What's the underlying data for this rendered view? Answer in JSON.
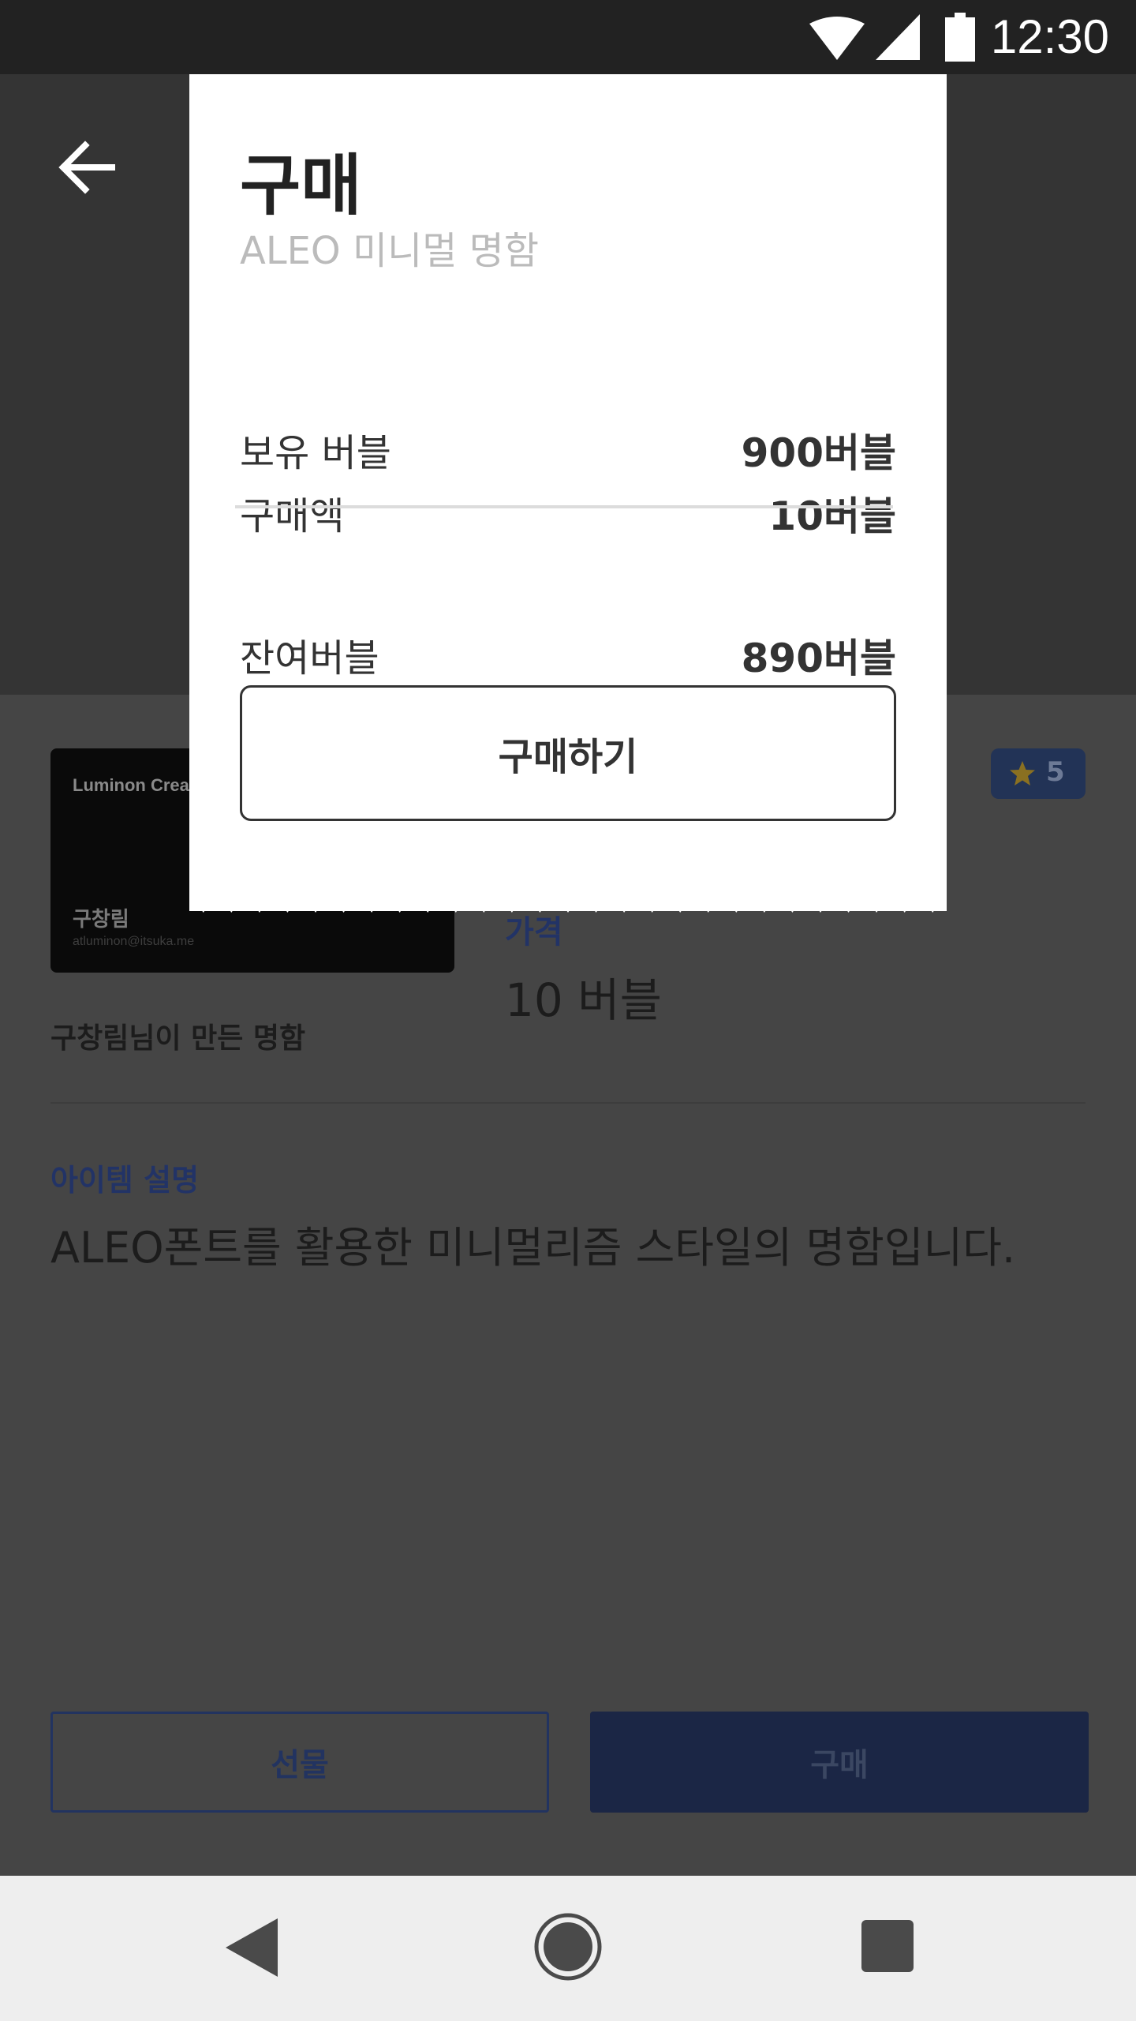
{
  "status_bar": {
    "time": "12:30",
    "icons": [
      "wifi-icon",
      "signal-icon",
      "battery-icon"
    ]
  },
  "header": {
    "back_icon": "arrow-left-icon"
  },
  "item": {
    "card": {
      "company": "Luminon Crea",
      "name": "구창림",
      "email": "atluminon@itsuka.me"
    },
    "maker": "구창림님이 만든 명함",
    "rating": "5",
    "price_label": "가격",
    "price_value": "10 버블",
    "description_label": "아이템 설명",
    "description": "ALEO폰트를 활용한 미니멀리즘 스타일의 명함입니다."
  },
  "actions": {
    "gift_label": "선물",
    "buy_label": "구매"
  },
  "modal": {
    "title": "구매",
    "subtitle": "ALEO 미니멀 명함",
    "rows": [
      {
        "label": "보유 버블",
        "value": "900버블"
      },
      {
        "label": "구매액",
        "value": "10버블"
      }
    ],
    "remaining": {
      "label": "잔여버블",
      "value": "890버블"
    },
    "purchase_label": "구매하기"
  },
  "nav_bar": {
    "icons": [
      "back-triangle-icon",
      "home-circle-icon",
      "recent-square-icon"
    ]
  },
  "colors": {
    "accent": "#223366",
    "modal_bg": "#ffffff",
    "overlay": "#343434"
  }
}
